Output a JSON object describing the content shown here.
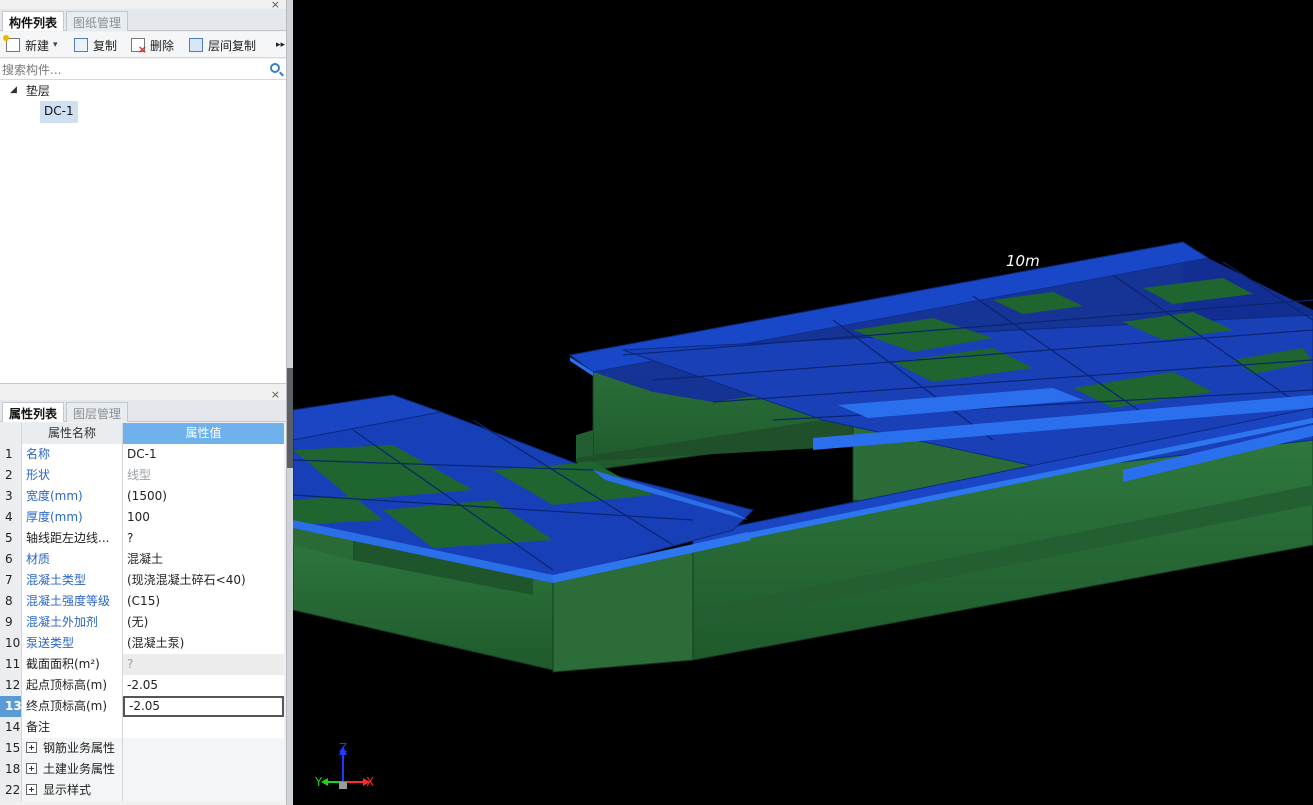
{
  "component_panel": {
    "tabs": [
      "构件列表",
      "图纸管理"
    ],
    "toolbar": {
      "new_label": "新建",
      "copy_label": "复制",
      "delete_label": "删除",
      "floor_copy_label": "层间复制"
    },
    "search_placeholder": "搜索构件...",
    "tree": {
      "category": "垫层",
      "selected_item": "DC-1"
    }
  },
  "property_panel": {
    "tabs": [
      "属性列表",
      "图层管理"
    ],
    "columns": [
      "属性名称",
      "属性值"
    ],
    "rows": [
      {
        "no": "1",
        "name": "名称",
        "value": "DC-1"
      },
      {
        "no": "2",
        "name": "形状",
        "value": "线型"
      },
      {
        "no": "3",
        "name": "宽度(mm)",
        "value": "(1500)"
      },
      {
        "no": "4",
        "name": "厚度(mm)",
        "value": "100"
      },
      {
        "no": "5",
        "name": "轴线距左边线...",
        "value": "?"
      },
      {
        "no": "6",
        "name": "材质",
        "value": "混凝土"
      },
      {
        "no": "7",
        "name": "混凝土类型",
        "value": "(现浇混凝土碎石<40)"
      },
      {
        "no": "8",
        "name": "混凝土强度等级",
        "value": "(C15)"
      },
      {
        "no": "9",
        "name": "混凝土外加剂",
        "value": "(无)"
      },
      {
        "no": "10",
        "name": "泵送类型",
        "value": "(混凝土泵)"
      },
      {
        "no": "11",
        "name": "截面面积(m²)",
        "value": "?"
      },
      {
        "no": "12",
        "name": "起点顶标高(m)",
        "value": "-2.05"
      },
      {
        "no": "13",
        "name": "终点顶标高(m)",
        "value": "-2.05"
      },
      {
        "no": "14",
        "name": "备注",
        "value": ""
      },
      {
        "no": "15",
        "name": "钢筋业务属性",
        "value": ""
      },
      {
        "no": "18",
        "name": "土建业务属性",
        "value": ""
      },
      {
        "no": "22",
        "name": "显示样式",
        "value": ""
      }
    ]
  },
  "viewport": {
    "scale_label": "10m",
    "axis_labels": {
      "z": "Z",
      "y": "Y",
      "x": "X"
    },
    "colors": {
      "foundation_side": "#2a6b3a",
      "cushion_top": "#1448c8",
      "background": "#000000"
    }
  }
}
